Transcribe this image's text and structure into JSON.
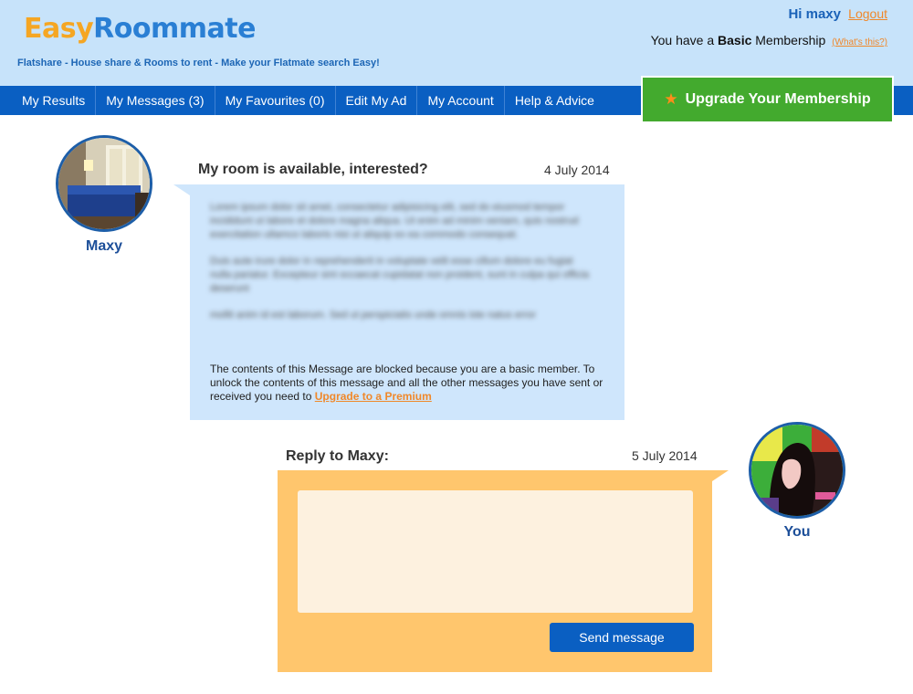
{
  "header": {
    "logo_easy": "Easy",
    "logo_roommate": "Roommate",
    "tagline": "Flatshare - House share & Rooms to rent - Make your Flatmate search Easy!",
    "greeting": "Hi maxy",
    "logout_label": "Logout",
    "membership_prefix": "You have a",
    "membership_level": "Basic",
    "membership_suffix": "Membership",
    "whats_this_label": "(What's this?)"
  },
  "nav": {
    "items": [
      {
        "label": "My Results"
      },
      {
        "label": "My Messages (3)"
      },
      {
        "label": "My Favourites (0)"
      },
      {
        "label": "Edit My Ad"
      },
      {
        "label": "My Account"
      },
      {
        "label": "Help & Advice"
      }
    ],
    "upgrade_label": "Upgrade Your Membership",
    "upgrade_icon": "star-icon"
  },
  "message": {
    "sender_name": "Maxy",
    "subject": "My room is available, interested?",
    "date": "4 July 2014",
    "blurred_paragraphs": [
      "Lorem ipsum dolor sit amet, consectetur adipisicing elit, sed do eiusmod tempor incididunt ut labore et dolore magna aliqua. Ut enim ad minim veniam, quis nostrud exercitation ullamco laboris nisi ut aliquip ex ea commodo consequat.",
      "Duis aute irure dolor in reprehenderit in voluptate velit esse cillum dolore eu fugiat nulla pariatur. Excepteur sint occaecat cupidatat non proident, sunt in culpa qui officia deserunt",
      "mollit anim id est laborum. Sed ut perspiciatis unde omnis iste natus error"
    ],
    "blocked_text": "The contents of this Message are blocked because you are a basic member. To unlock the contents of this message and all the other messages you have sent or received you need to",
    "upgrade_link": "Upgrade to a Premium"
  },
  "reply": {
    "heading": "Reply to Maxy:",
    "date": "5 July 2014",
    "input_value": "",
    "send_label": "Send message",
    "user_name": "You"
  },
  "colors": {
    "header_bg": "#c7e3fa",
    "nav_bg": "#0a5fc2",
    "upgrade_bg": "#43aa2e",
    "message_bg": "#cfe6fc",
    "reply_bg": "#ffc66d",
    "accent_orange": "#f0882a"
  }
}
